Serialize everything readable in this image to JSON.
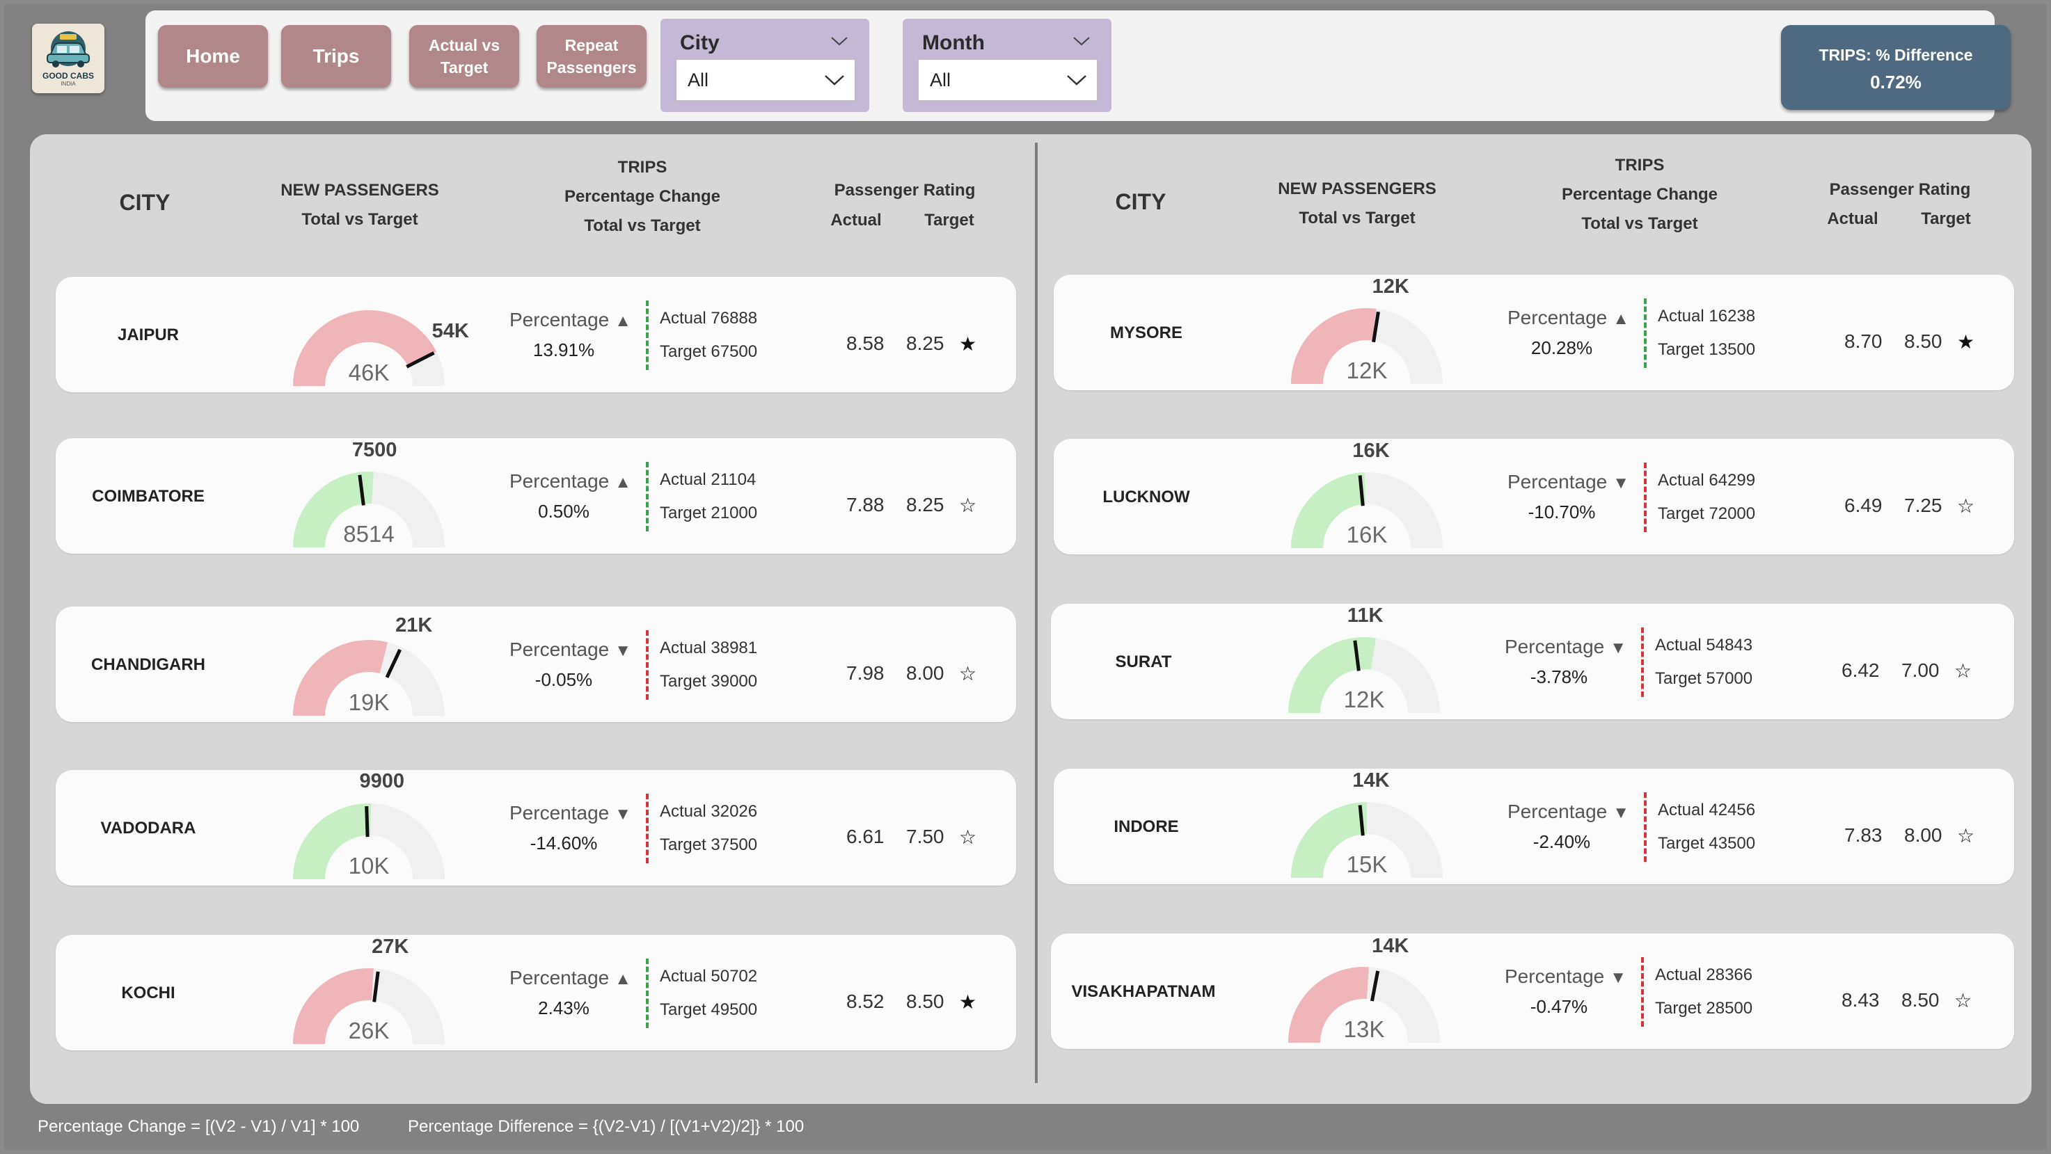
{
  "logo": {
    "name": "GOOD CABS",
    "sub": "INDIA"
  },
  "nav": [
    {
      "label": "Home"
    },
    {
      "label": "Trips"
    },
    {
      "label_l1": "Actual vs",
      "label_l2": "Target"
    },
    {
      "label_l1": "Repeat",
      "label_l2": "Passengers"
    }
  ],
  "filters": {
    "city": {
      "title": "City",
      "value": "All"
    },
    "month": {
      "title": "Month",
      "value": "All"
    }
  },
  "kpi": {
    "label": "TRIPS: % Difference",
    "value": "0.72%"
  },
  "headers": {
    "city": "CITY",
    "np_l1": "NEW PASSENGERS",
    "np_l2": "Total vs Target",
    "tr_l1": "TRIPS",
    "tr_l2": "Percentage Change",
    "tr_l3": "Total vs Target",
    "pr_l1": "Passenger Rating",
    "pr_actual": "Actual",
    "pr_target": "Target"
  },
  "cities": [
    {
      "name": "JAIPUR",
      "new_actual": "46K",
      "new_target": "54K",
      "fill": 0.85,
      "target_pos": 0.85,
      "gauge_color": "#f0b5b8",
      "pct_label": "Percentage",
      "dir": "up",
      "pct": "13.91%",
      "actual": "Actual 76888",
      "target": "Target 67500",
      "rating_actual": "8.58",
      "rating_target": "8.25",
      "star": "★"
    },
    {
      "name": "COIMBATORE",
      "new_actual": "8514",
      "new_target": "7500",
      "fill": 0.52,
      "target_pos": 0.46,
      "gauge_color": "#c7efc4",
      "pct_label": "Percentage",
      "dir": "up",
      "pct": "0.50%",
      "actual": "Actual 21104",
      "target": "Target 21000",
      "rating_actual": "7.88",
      "rating_target": "8.25",
      "star": "☆"
    },
    {
      "name": "CHANDIGARH",
      "new_actual": "19K",
      "new_target": "21K",
      "fill": 0.58,
      "target_pos": 0.64,
      "gauge_color": "#f0b5b8",
      "pct_label": "Percentage",
      "dir": "down",
      "pct": "-0.05%",
      "actual": "Actual 38981",
      "target": "Target 39000",
      "rating_actual": "7.98",
      "rating_target": "8.00",
      "star": "☆"
    },
    {
      "name": "VADODARA",
      "new_actual": "10K",
      "new_target": "9900",
      "fill": 0.51,
      "target_pos": 0.49,
      "gauge_color": "#c7efc4",
      "pct_label": "Percentage",
      "dir": "down",
      "pct": "-14.60%",
      "actual": "Actual 32026",
      "target": "Target 37500",
      "rating_actual": "6.61",
      "rating_target": "7.50",
      "star": "☆"
    },
    {
      "name": "KOCHI",
      "new_actual": "26K",
      "new_target": "27K",
      "fill": 0.52,
      "target_pos": 0.54,
      "gauge_color": "#f0b5b8",
      "pct_label": "Percentage",
      "dir": "up",
      "pct": "2.43%",
      "actual": "Actual 50702",
      "target": "Target 49500",
      "rating_actual": "8.52",
      "rating_target": "8.50",
      "star": "★"
    },
    {
      "name": "MYSORE",
      "new_actual": "12K",
      "new_target": "12K",
      "fill": 0.54,
      "target_pos": 0.55,
      "gauge_color": "#f0b5b8",
      "pct_label": "Percentage",
      "dir": "up",
      "pct": "20.28%",
      "actual": "Actual 16238",
      "target": "Target 13500",
      "rating_actual": "8.70",
      "rating_target": "8.50",
      "star": "★"
    },
    {
      "name": "LUCKNOW",
      "new_actual": "16K",
      "new_target": "16K",
      "fill": 0.49,
      "target_pos": 0.47,
      "gauge_color": "#c7efc4",
      "pct_label": "Percentage",
      "dir": "down",
      "pct": "-10.70%",
      "actual": "Actual 64299",
      "target": "Target 72000",
      "rating_actual": "6.49",
      "rating_target": "7.25",
      "star": "☆"
    },
    {
      "name": "SURAT",
      "new_actual": "12K",
      "new_target": "11K",
      "fill": 0.55,
      "target_pos": 0.46,
      "gauge_color": "#c7efc4",
      "pct_label": "Percentage",
      "dir": "down",
      "pct": "-3.78%",
      "actual": "Actual 54843",
      "target": "Target 57000",
      "rating_actual": "6.42",
      "rating_target": "7.00",
      "star": "☆"
    },
    {
      "name": "INDORE",
      "new_actual": "15K",
      "new_target": "14K",
      "fill": 0.5,
      "target_pos": 0.47,
      "gauge_color": "#c7efc4",
      "pct_label": "Percentage",
      "dir": "down",
      "pct": "-2.40%",
      "actual": "Actual 42456",
      "target": "Target 43500",
      "rating_actual": "7.83",
      "rating_target": "8.00",
      "star": "☆"
    },
    {
      "name": "VISAKHAPATNAM",
      "new_actual": "13K",
      "new_target": "14K",
      "fill": 0.52,
      "target_pos": 0.56,
      "gauge_color": "#f0b5b8",
      "pct_label": "Percentage",
      "dir": "down",
      "pct": "-0.47%",
      "actual": "Actual 28366",
      "target": "Target 28500",
      "rating_actual": "8.43",
      "rating_target": "8.50",
      "star": "☆"
    }
  ],
  "footnotes": {
    "change": "Percentage Change = [(V2 - V1) / V1] * 100",
    "difference": "Percentage Difference = {(V2-V1) / [(V1+V2)/2]} * 100"
  }
}
